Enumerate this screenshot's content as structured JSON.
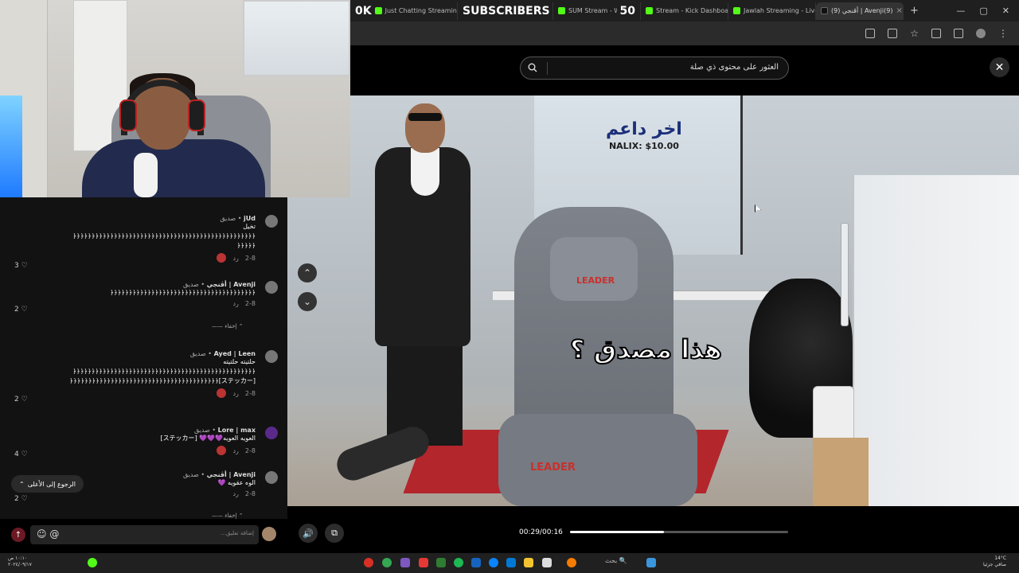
{
  "browser": {
    "tabs": [
      {
        "overlay_count": "0K",
        "label": "Just Chatting Streamin",
        "fav": "kick"
      },
      {
        "overlay_label": "SUBSCRIBERS",
        "label": "",
        "fav": "none"
      },
      {
        "label": "SUM Stream - Watch L",
        "overlay_count": "50",
        "fav": "kick"
      },
      {
        "label": "Stream - Kick Dashboar",
        "fav": "kick"
      },
      {
        "label": "Jawlah Streaming - Live",
        "fav": "kick"
      },
      {
        "label": "(9) أڤنجي | Avenji(9)",
        "fav": "tiktok"
      }
    ],
    "new_tab": "+",
    "window_controls": [
      "—",
      "▢",
      "✕"
    ]
  },
  "search": {
    "placeholder": "العثور على محتوى ذي صلة"
  },
  "close_label": "✕",
  "video": {
    "supporter_title": "اخر داعم",
    "supporter_line": "NALIX: $10.00",
    "caption": "هذا مصدق ؟",
    "chair_brand": "LEADER",
    "nav_up": "⌃",
    "nav_down": "⌄"
  },
  "comments": [
    {
      "user": "jUd",
      "tag": "صديق",
      "text": "تخيل\n﴿﴿﴿﴿﴿﴿﴿﴿﴿﴿﴿﴿﴿﴿﴿﴿﴿﴿﴿﴿﴿﴿﴿﴿﴿﴿﴿﴿﴿﴿﴿﴿﴿﴿﴿﴿﴿﴿﴿﴿﴿﴿﴿﴿﴿﴿﴿﴿﴿\n﴿﴿﴿﴿﴿",
      "date": "2-8",
      "reply": "رد",
      "likes": "3"
    },
    {
      "user": "Avenji | أڤنجي",
      "tag": "صديق",
      "text": "﴿﴿﴿﴿﴿﴿﴿﴿﴿﴿﴿﴿﴿﴿﴿﴿﴿﴿﴿﴿﴿﴿﴿﴿﴿﴿﴿﴿﴿﴿﴿﴿﴿﴿﴿﴿﴿﴿﴿",
      "date": "2-8",
      "reply": "رد",
      "likes": "2",
      "hide": "إخفاء"
    },
    {
      "user": "Ayed | Leen",
      "tag": "صديق",
      "text": "حلتيته حلتيته\n﴿﴿﴿﴿﴿﴿﴿﴿﴿﴿﴿﴿﴿﴿﴿﴿﴿﴿﴿﴿﴿﴿﴿﴿﴿﴿﴿﴿﴿﴿﴿﴿﴿﴿﴿﴿﴿﴿﴿﴿﴿﴿﴿﴿﴿﴿﴿﴿﴿\n[ステッカー]﴿﴿﴿﴿﴿﴿﴿﴿﴿﴿﴿﴿﴿﴿﴿﴿﴿﴿﴿﴿﴿﴿﴿﴿﴿﴿﴿﴿﴿﴿﴿﴿﴿﴿﴿﴿﴿﴿﴿﴿",
      "date": "2-8",
      "reply": "رد",
      "likes": "2"
    },
    {
      "user": "Lore | max",
      "tag": "صديق",
      "text": "العويه العويه💜💜💜 [ステッカー]",
      "date": "2-8",
      "reply": "رد",
      "likes": "4"
    },
    {
      "user": "Avenji | أڤنجي",
      "tag": "صديق",
      "text": "الوه عقويه 💜",
      "date": "2-8",
      "reply": "رد",
      "likes": "2",
      "hide": "إخفاء"
    }
  ],
  "back_to_top": "الرجوع إلى الأعلى",
  "reply_placeholder": "إضافة تعليق...",
  "reply_icons": "☺ @",
  "player": {
    "time": "00:29/00:16",
    "progress": 0.43
  },
  "taskbar": {
    "search_label": "بحث",
    "clock": "١٠:١٠ ص\n٢٠٢٤/٠٩/١٧",
    "weather": "14°C\nصافي جزئيا"
  },
  "colors": {
    "accent": "#53fc18",
    "tiktok_red": "#fe2c55",
    "caption_blue": "#1c2f7a"
  }
}
